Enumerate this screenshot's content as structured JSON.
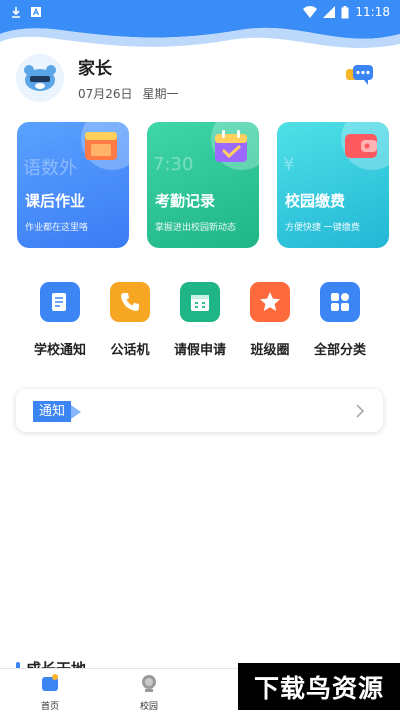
{
  "status_bar": {
    "time": "11:18"
  },
  "profile": {
    "name": "家长",
    "date": "07月26日",
    "weekday": "星期一"
  },
  "cards": [
    {
      "title": "课后作业",
      "subtitle": "作业都在这里咯",
      "ghost": "语数外"
    },
    {
      "title": "考勤记录",
      "subtitle": "掌握进出校园新动态",
      "ghost": "7:30"
    },
    {
      "title": "校园缴费",
      "subtitle": "方便快捷 一键缴费",
      "ghost": "¥"
    }
  ],
  "services": [
    {
      "label": "学校通知",
      "icon": "school-notice-icon",
      "color": "#3b85f5"
    },
    {
      "label": "公话机",
      "icon": "phone-icon",
      "color": "#f5a623"
    },
    {
      "label": "请假申请",
      "icon": "calendar-icon",
      "color": "#1fb586"
    },
    {
      "label": "班级圈",
      "icon": "star-icon",
      "color": "#ff6a3d"
    },
    {
      "label": "全部分类",
      "icon": "grid-icon",
      "color": "#3b85f5"
    }
  ],
  "notice": {
    "tag": "通知"
  },
  "growth": {
    "title": "成长天地"
  },
  "bottom_nav": [
    {
      "label": "首页",
      "icon": "home-icon"
    },
    {
      "label": "校园",
      "icon": "campus-icon"
    }
  ],
  "watermark": {
    "text": "下载鸟资源"
  },
  "colors": {
    "primary": "#3b85f5",
    "header": "#3a8df6"
  }
}
